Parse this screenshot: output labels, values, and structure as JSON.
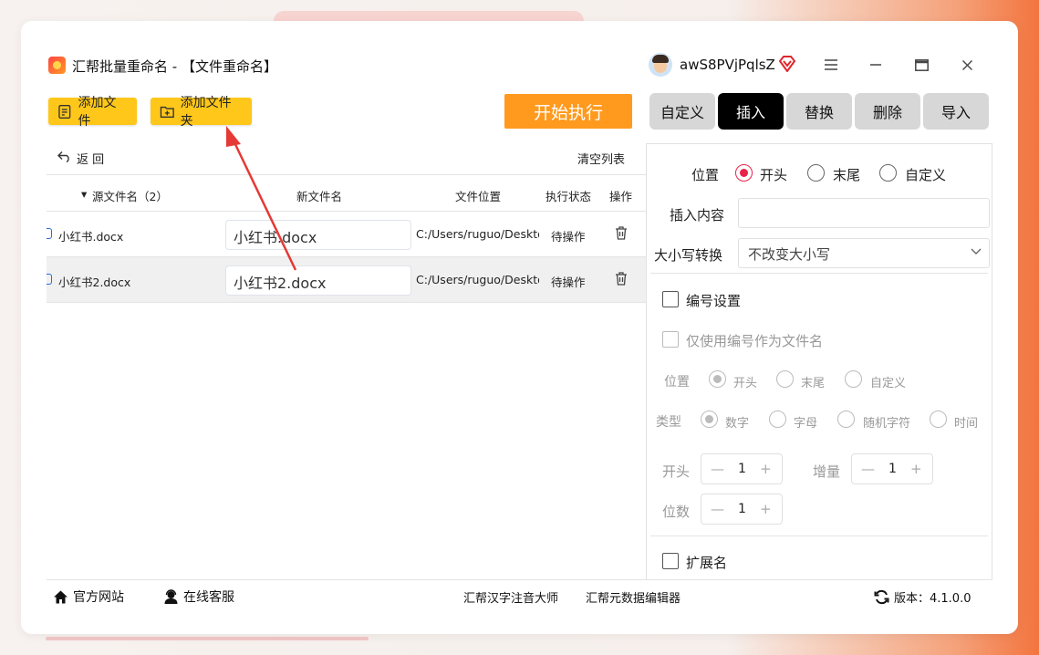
{
  "app": {
    "title": "汇帮批量重命名 - 【文件重命名】",
    "username": "awS8PVjPqlsZ"
  },
  "toolbar": {
    "add_file": "添加文件",
    "add_folder": "添加文件夹",
    "start": "开始执行"
  },
  "tabs": [
    {
      "label": "自定义",
      "active": false
    },
    {
      "label": "插入",
      "active": true
    },
    {
      "label": "替换",
      "active": false
    },
    {
      "label": "删除",
      "active": false
    },
    {
      "label": "导入",
      "active": false
    }
  ],
  "list": {
    "back_label": "返 回",
    "clear_label": "清空列表",
    "columns": {
      "source": "源文件名（2）",
      "new_name": "新文件名",
      "location": "文件位置",
      "status": "执行状态",
      "action": "操作"
    },
    "rows": [
      {
        "source": "小红书.docx",
        "new_name": "小红书.docx",
        "location": "C:/Users/ruguo/Deskto",
        "status": "待操作"
      },
      {
        "source": "小红书2.docx",
        "new_name": "小红书2.docx",
        "location": "C:/Users/ruguo/Deskto",
        "status": "待操作"
      }
    ]
  },
  "panel": {
    "position_label": "位置",
    "position_options": [
      "开头",
      "末尾",
      "自定义"
    ],
    "position_selected": "开头",
    "insert_label": "插入内容",
    "insert_value": "",
    "case_label": "大小写转换",
    "case_value": "不改变大小写",
    "numbering_label": "编号设置",
    "number_only_label": "仅使用编号作为文件名",
    "num_position_label": "位置",
    "num_position_options": [
      "开头",
      "末尾",
      "自定义"
    ],
    "num_type_label": "类型",
    "num_type_options": [
      "数字",
      "字母",
      "随机字符",
      "时间"
    ],
    "start_label": "开头",
    "start_value": "1",
    "increment_label": "增量",
    "increment_value": "1",
    "digits_label": "位数",
    "digits_value": "1",
    "extension_label": "扩展名"
  },
  "footer": {
    "website": "官方网站",
    "support": "在线客服",
    "link1": "汇帮汉字注音大师",
    "link2": "汇帮元数据编辑器",
    "version": "版本：4.1.0.0"
  },
  "colors": {
    "accent_yellow": "#ffc71a",
    "start_orange": "#ff9a1e",
    "radio_red": "#e8234a",
    "arrow_red": "#e53935"
  }
}
